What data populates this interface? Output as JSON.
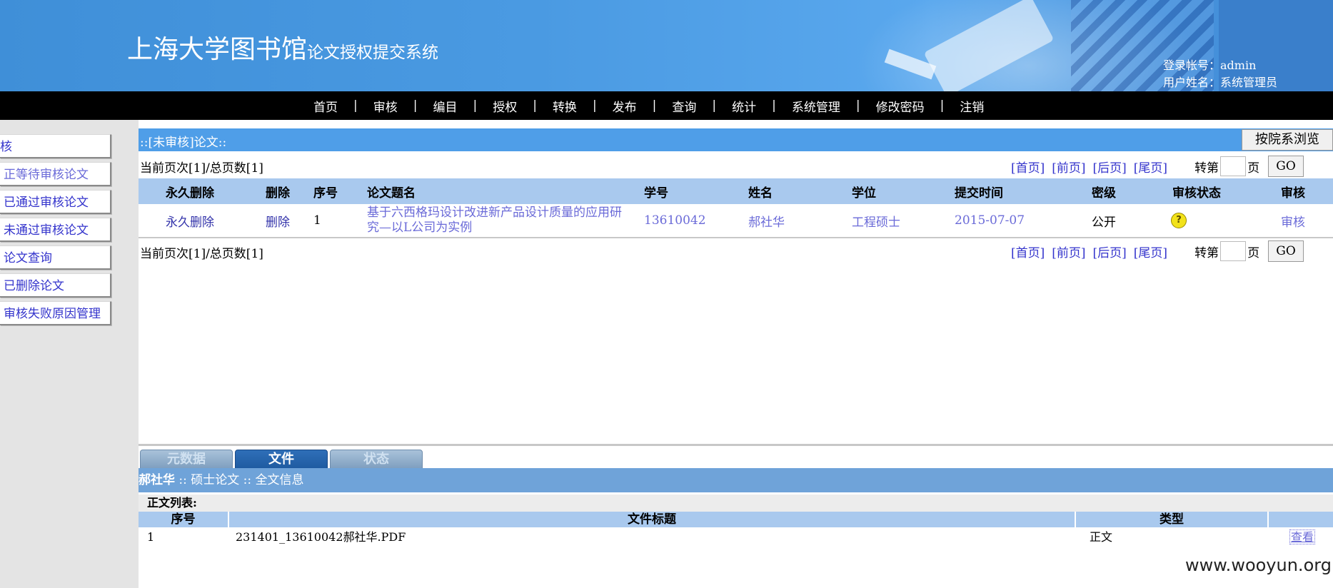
{
  "header": {
    "title_main": "上海大学图书馆",
    "title_sub": "论文授权提交系统",
    "login_account": "登录帐号：admin",
    "user_name": "用户姓名：系统管理员"
  },
  "nav": {
    "items": [
      "首页",
      "审核",
      "编目",
      "授权",
      "转换",
      "发布",
      "查询",
      "统计",
      "系统管理",
      "修改密码",
      "注销"
    ],
    "separator": "|"
  },
  "sidebar": {
    "items": [
      {
        "label": "核"
      },
      {
        "label": "正等待审核论文",
        "active": true
      },
      {
        "label": "已通过审核论文"
      },
      {
        "label": "未通过审核论文"
      },
      {
        "label": "论文查询"
      },
      {
        "label": "已删除论文"
      },
      {
        "label": "审核失败原因管理"
      }
    ]
  },
  "section": {
    "title": "::[未审核]论文::",
    "browse_button": "按院系浏览"
  },
  "pager": {
    "status": "当前页次[1]/总页数[1]",
    "first": "[首页]",
    "prev": "[前页]",
    "next": "[后页]",
    "last": "[尾页]",
    "goto_prefix": "转第",
    "goto_suffix": "页",
    "go": "GO"
  },
  "table": {
    "headers": {
      "perm_delete": "永久删除",
      "delete": "删除",
      "seq": "序号",
      "title": "论文题名",
      "student_id": "学号",
      "name": "姓名",
      "degree": "学位",
      "submit_time": "提交时间",
      "secrecy": "密级",
      "review_status": "审核状态",
      "review": "审核"
    },
    "rows": [
      {
        "perm_delete": "永久删除",
        "delete": "删除",
        "seq": "1",
        "title_line1": "基于六西格玛设计改进新产品设计质量的应用研",
        "title_line2": "究—以L公司为实例",
        "student_id": "13610042",
        "name": "郝社华",
        "degree": "工程硕士",
        "submit_time": "2015-07-07",
        "secrecy": "公开",
        "status_icon": "question-icon",
        "review": "审核"
      }
    ]
  },
  "tabs": [
    {
      "label": "元数据",
      "active": false
    },
    {
      "label": "文件",
      "active": true
    },
    {
      "label": "状态",
      "active": false
    }
  ],
  "info_bar": {
    "name": "郝社华",
    "rest": " :: 硕士论文 :: 全文信息"
  },
  "files": {
    "list_label": "正文列表:",
    "headers": {
      "seq": "序号",
      "title": "文件标题",
      "type": "类型"
    },
    "rows": [
      {
        "seq": "1",
        "title": "231401_13610042郝社华.PDF",
        "type": "正文",
        "action": "查看"
      }
    ]
  },
  "watermark": "www.wooyun.org",
  "colors": {
    "header_blue": "#4a9ae2",
    "nav_black": "#000000",
    "section_blue": "#4f9ee8",
    "grid_head": "#a9c9ee",
    "link": "#6a6ad8",
    "status_yellow": "#f2e21a"
  }
}
